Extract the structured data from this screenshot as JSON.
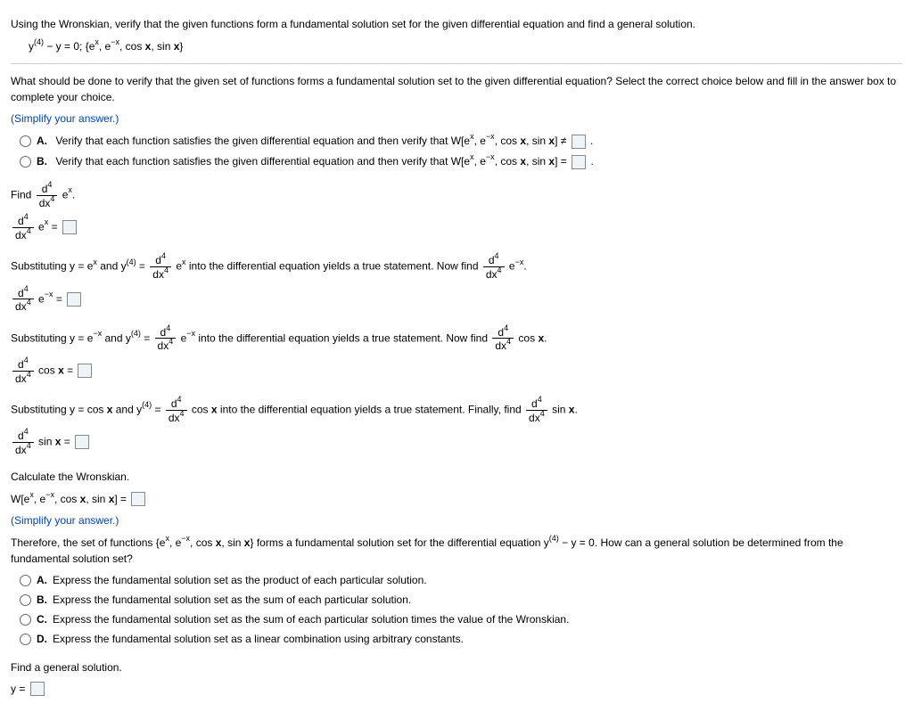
{
  "q": {
    "intro": "Using the Wronskian, verify that the given functions form a fundamental solution set for the given differential equation and find a general solution.",
    "eq_pre": "y",
    "eq_exp": "(4)",
    "eq_rest": " − y = 0;  {e",
    "eq_x": "x",
    "eq_mid": ",  e",
    "eq_negx": "−x",
    "eq_cos": ",  cos",
    "eq_sin": ",  sin",
    "eq_close": "}",
    "prompt": "What should be done to verify that the given set of functions forms a fundamental solution set to the given differential equation? Select the correct choice below and fill in the answer box to complete your choice.",
    "simp": "(Simplify your answer.)",
    "optA_pre": "Verify that each function satisfies the given differential equation and then verify that W[e",
    "optA_mid1": ",  e",
    "optA_mid2": ",  cos",
    "optA_mid3": ",  sin",
    "optA_end": "] ≠",
    "optB_pre": "Verify that each function satisfies the given differential equation and then verify that W[e",
    "optB_end": "] =",
    "find": "Find",
    "d4": "d",
    "dpow": "4",
    "dx": "dx",
    "dxpow": "4",
    "ex": "e",
    "x": "x",
    "negx": "−x",
    "cosx": "cos",
    "sinx": "sin",
    "sub1": "Substituting y = e",
    "and": " and y",
    "yexp": "(4)",
    "eq": " = ",
    "into": " into the differential equation yields a true statement. Now find",
    "sub3": "Substituting y = cos",
    "finally": " into the differential equation yields a true statement. Finally, find",
    "calc": "Calculate the Wronskian.",
    "W": "W[e",
    "Wend": "] =",
    "simp2": "(Simplify your answer.)",
    "there": "Therefore, the set of functions {e",
    "there_mid": " forms a fundamental solution set for the differential equation y",
    "there_end": " − y = 0. How can a general solution be determined from the fundamental solution set?",
    "cA": "Express the fundamental solution set as the product of each particular solution.",
    "cB": "Express the fundamental solution set as the sum of each particular solution.",
    "cC": "Express the fundamental solution set as the sum of each particular solution times the value of the Wronskian.",
    "cD": "Express the fundamental solution set as a linear combination using arbitrary constants.",
    "findgen": "Find a general solution.",
    "yeq": "y ="
  }
}
